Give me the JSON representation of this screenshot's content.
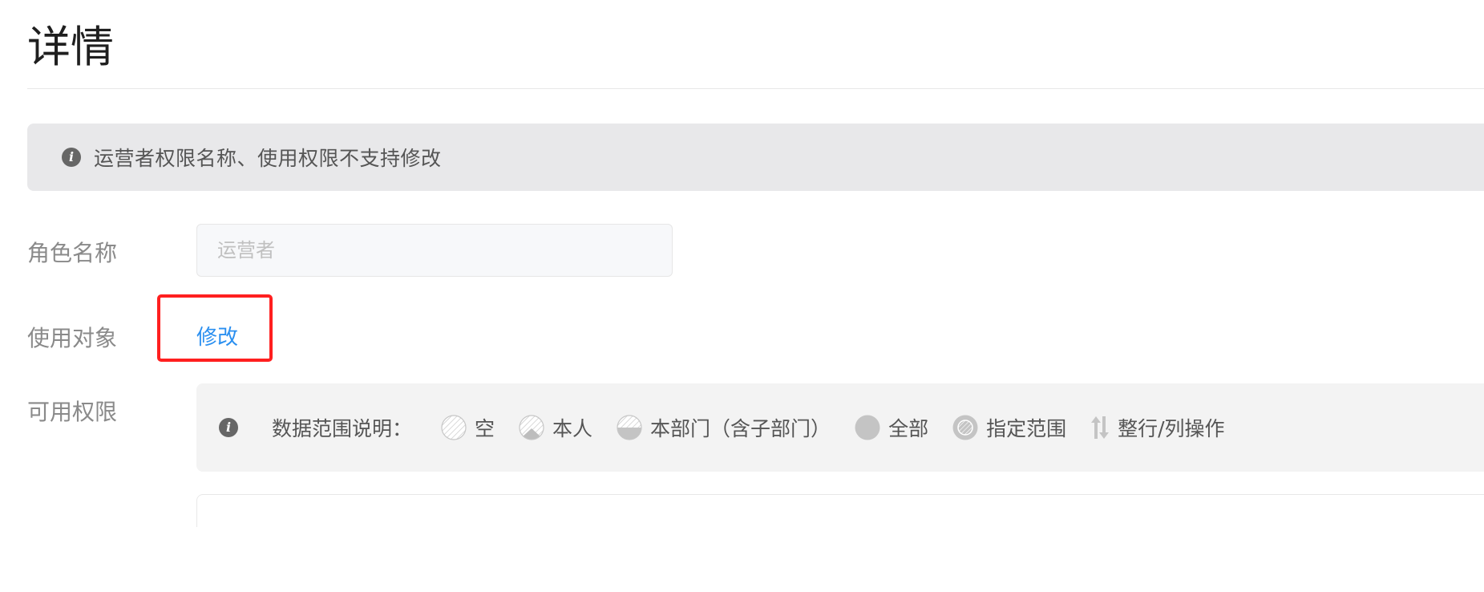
{
  "page": {
    "title": "详情"
  },
  "notice": {
    "icon": "info-icon",
    "text": "运营者权限名称、使用权限不支持修改"
  },
  "form": {
    "role_name": {
      "label": "角色名称",
      "placeholder": "运营者"
    },
    "target": {
      "label": "使用对象",
      "action_label": "修改"
    },
    "permissions": {
      "label": "可用权限"
    }
  },
  "scope_legend": {
    "icon": "info-icon",
    "heading": "数据范围说明：",
    "items": [
      {
        "label": "空",
        "icon": "empty-scope-icon"
      },
      {
        "label": "本人",
        "icon": "self-scope-icon"
      },
      {
        "label": "本部门（含子部门）",
        "icon": "department-scope-icon"
      },
      {
        "label": "全部",
        "icon": "all-scope-icon"
      },
      {
        "label": "指定范围",
        "icon": "specified-scope-icon"
      },
      {
        "label": "整行/列操作",
        "icon": "row-column-operation-icon"
      }
    ]
  },
  "colors": {
    "accent": "#2a8ff0",
    "highlight": "#ff1f1f",
    "notice_background": "#e8e8ea",
    "panel_background": "#f3f3f3"
  }
}
